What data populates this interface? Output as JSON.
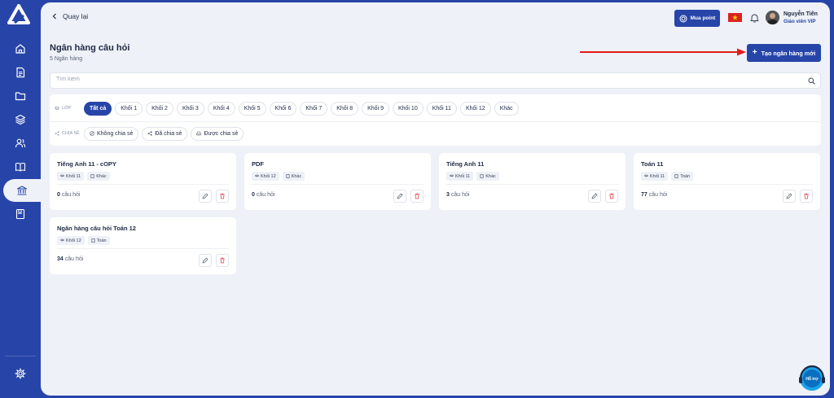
{
  "colors": {
    "primary": "#2745a8",
    "background": "#eef1f7",
    "danger": "#e5484d",
    "annotation_arrow": "#e31b1b"
  },
  "sidebar": {
    "items": [
      {
        "icon": "home-icon"
      },
      {
        "icon": "document-icon"
      },
      {
        "icon": "folder-icon"
      },
      {
        "icon": "layers-icon"
      },
      {
        "icon": "users-icon"
      },
      {
        "icon": "book-open-icon"
      },
      {
        "icon": "bank-icon",
        "active": true
      },
      {
        "icon": "notebook-icon"
      }
    ],
    "settings_icon": "gear-icon"
  },
  "header": {
    "back_label": "Quay lại",
    "mua_point_label": "Mua point",
    "user_name": "Nguyễn Tiến",
    "user_role": "Giáo viên VIP"
  },
  "page": {
    "title": "Ngân hàng câu hỏi",
    "subtitle": "5 Ngân hàng",
    "create_button_label": "Tạo ngân hàng mới"
  },
  "search": {
    "placeholder": "Tìm kiếm",
    "value": ""
  },
  "filters": {
    "grade_label": "LỚP",
    "grades": [
      "Tất cả",
      "Khối 1",
      "Khối 2",
      "Khối 3",
      "Khối 4",
      "Khối 5",
      "Khối 6",
      "Khối 7",
      "Khối 8",
      "Khối 9",
      "Khối 10",
      "Khối 11",
      "Khối 12",
      "Khác"
    ],
    "selected_grade": "Tất cả",
    "share_label": "CHIA SẺ",
    "share_options": [
      "Không chia sẻ",
      "Đã chia sẻ",
      "Được chia sẻ"
    ]
  },
  "banks": [
    {
      "title": "Tiếng Anh 11 - cOPY",
      "grade": "Khối 11",
      "subject": "Khác",
      "count": "0",
      "count_suffix": "câu hỏi"
    },
    {
      "title": "PDF",
      "grade": "Khối 12",
      "subject": "Khác",
      "count": "0",
      "count_suffix": "câu hỏi"
    },
    {
      "title": "Tiếng Anh 11",
      "grade": "Khối 11",
      "subject": "Khác",
      "count": "3",
      "count_suffix": "câu hỏi"
    },
    {
      "title": "Toán 11",
      "grade": "Khối 11",
      "subject": "Toán",
      "count": "77",
      "count_suffix": "câu hỏi"
    },
    {
      "title": "Ngân hàng câu hỏi Toán 12",
      "grade": "Khối 12",
      "subject": "Toán",
      "count": "34",
      "count_suffix": "câu hỏi"
    }
  ],
  "support_badge": "Hỗ trợ"
}
